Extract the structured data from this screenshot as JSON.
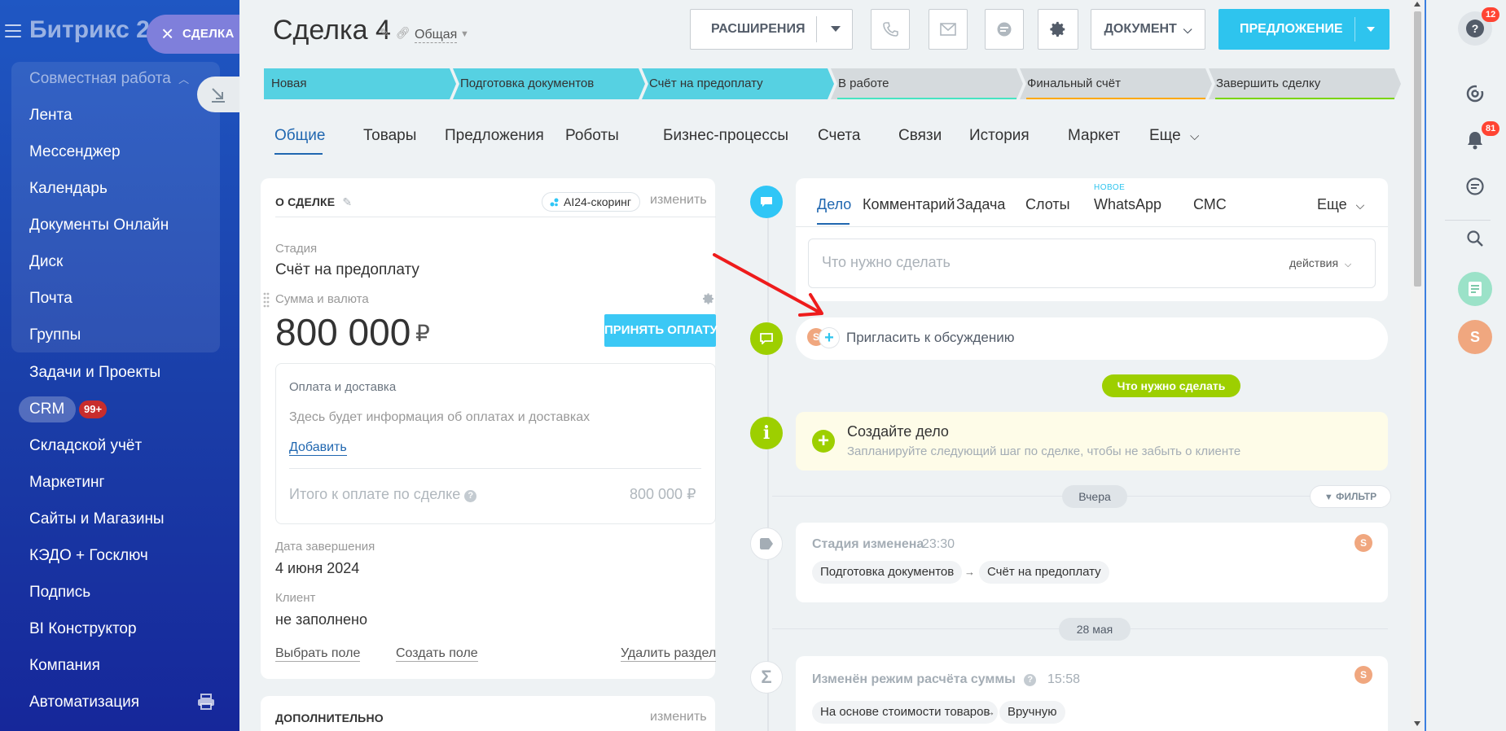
{
  "sidebar": {
    "logo": "Битрикс 24",
    "group_title": "Совместная работа",
    "group_items": [
      {
        "label": "Лента"
      },
      {
        "label": "Мессенджер"
      },
      {
        "label": "Календарь"
      },
      {
        "label": "Документы Онлайн"
      },
      {
        "label": "Диск"
      },
      {
        "label": "Почта"
      },
      {
        "label": "Группы"
      }
    ],
    "items": [
      {
        "label": "Задачи и Проекты"
      },
      {
        "label": "CRM"
      },
      {
        "label": "Складской учёт"
      },
      {
        "label": "Маркетинг"
      },
      {
        "label": "Сайты и Магазины"
      },
      {
        "label": "КЭДО + Госключ"
      },
      {
        "label": "Подпись"
      },
      {
        "label": "BI Конструктор"
      },
      {
        "label": "Компания"
      },
      {
        "label": "Автоматизация"
      }
    ],
    "crm_badge": "99+"
  },
  "slider": {
    "close_label": "СДЕЛКА"
  },
  "header": {
    "title": "Сделка 4",
    "category": "Общая",
    "extensions_label": "РАСШИРЕНИЯ",
    "document_label": "ДОКУМЕНТ",
    "offer_label": "ПРЕДЛОЖЕНИЕ"
  },
  "stages": [
    {
      "label": "Новая",
      "color": "#56d1e2",
      "done": true
    },
    {
      "label": "Подготовка документов",
      "color": "#56d1e2",
      "done": true
    },
    {
      "label": "Счёт на предоплату",
      "color": "#56d1e2",
      "done": true
    },
    {
      "label": "В работе",
      "color": "#47e4c2",
      "done": false
    },
    {
      "label": "Финальный счёт",
      "color": "#ffa900",
      "done": false
    },
    {
      "label": "Завершить сделку",
      "color": "#7bd500",
      "done": false
    }
  ],
  "tabs": [
    {
      "label": "Общие",
      "active": true
    },
    {
      "label": "Товары"
    },
    {
      "label": "Предложения"
    },
    {
      "label": "Роботы"
    },
    {
      "label": "Бизнес-процессы"
    },
    {
      "label": "Счета"
    },
    {
      "label": "Связи"
    },
    {
      "label": "История"
    },
    {
      "label": "Маркет"
    },
    {
      "label": "Еще"
    }
  ],
  "about": {
    "section_title": "О СДЕЛКЕ",
    "ai_label": "AI24-скоринг",
    "change_label": "изменить",
    "stage_label": "Стадия",
    "stage_value": "Счёт на предоплату",
    "amount_label": "Сумма и валюта",
    "amount_value": "800 000",
    "currency": "₽",
    "accept_payment": "ПРИНЯТЬ ОПЛАТУ",
    "payment_title": "Оплата и доставка",
    "payment_hint": "Здесь будет информация об оплатах и доставках",
    "add_link": "Добавить",
    "total_label": "Итого к оплате по сделке",
    "total_value": "800 000 ₽",
    "close_date_label": "Дата завершения",
    "close_date_value": "4 июня 2024",
    "client_label": "Клиент",
    "client_value": "не заполнено",
    "select_field": "Выбрать поле",
    "create_field": "Создать поле",
    "delete_section": "Удалить раздел"
  },
  "extra": {
    "section_title": "ДОПОЛНИТЕЛЬНО",
    "change_label": "изменить"
  },
  "composer": {
    "tabs": [
      {
        "label": "Дело",
        "active": true
      },
      {
        "label": "Комментарий"
      },
      {
        "label": "Задача"
      },
      {
        "label": "Слоты"
      },
      {
        "label": "WhatsApp"
      },
      {
        "label": "СМС"
      },
      {
        "label": "Еще"
      }
    ],
    "new_tag": "НОВОЕ",
    "placeholder": "Что нужно сделать",
    "actions_label": "действия"
  },
  "timeline": {
    "invite_label": "Пригласить к обсуждению",
    "todo_pill": "Что нужно сделать",
    "create_task_title": "Создайте дело",
    "create_task_hint": "Запланируйте следующий шаг по сделке, чтобы не забыть о клиенте",
    "yesterday": "Вчера",
    "filter_label": "ФИЛЬТР",
    "entry1": {
      "title": "Стадия изменена",
      "time": "23:30",
      "from": "Подготовка документов",
      "to": "Счёт на предоплату"
    },
    "date2": "28 мая",
    "entry2": {
      "title": "Изменён режим расчёта суммы",
      "time": "15:58",
      "from": "На основе стоимости товаров",
      "to": "Вручную"
    },
    "avatar_letter": "S"
  },
  "right_panel": {
    "help_badge": "12",
    "notif_badge": "81",
    "avatar_letter": "S"
  }
}
